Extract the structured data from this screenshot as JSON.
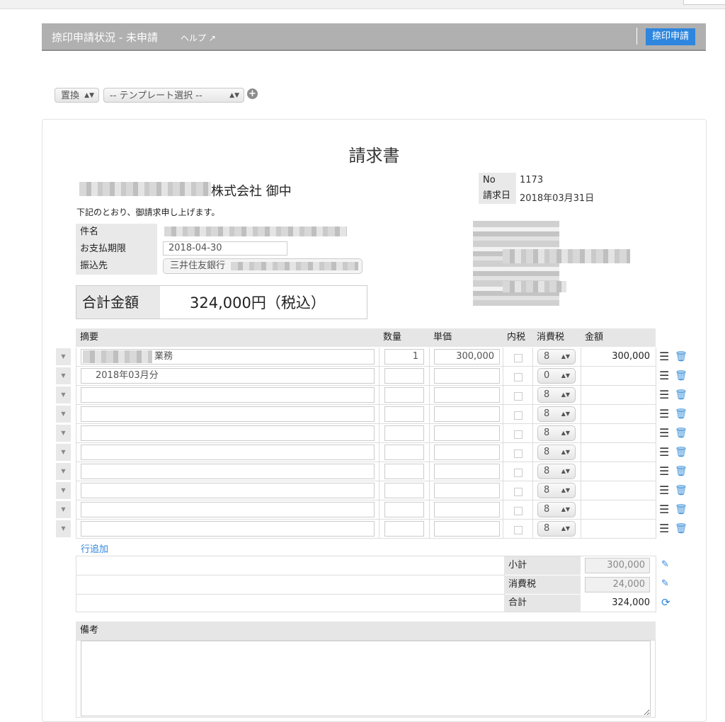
{
  "app": {
    "title": "捺印申請状況 - 未申請",
    "help_label": "ヘルプ",
    "help_icon": "↗",
    "apply_button": "捺印申請",
    "accent_color": "#2e86de"
  },
  "toolbar": {
    "replace_select": "置換",
    "template_select": "-- テンプレート選択 --",
    "add_icon": "+"
  },
  "invoice": {
    "title": "請求書",
    "recipient_suffix": "株式会社 御中",
    "intro": "下記のとおり、御請求申し上げます。",
    "no_label": "No",
    "no_value": "1173",
    "date_label": "請求日",
    "date_value": "2018年03月31日",
    "subject_label": "件名",
    "due_label": "お支払期限",
    "due_value": "2018-04-30",
    "bank_label": "振込先",
    "bank_value": "三井住友銀行",
    "total_label": "合計金額",
    "total_value": "324,000円（税込）"
  },
  "table": {
    "headers": {
      "description": "摘要",
      "quantity": "数量",
      "unit_price": "単価",
      "tax_included": "内税",
      "tax_rate": "消費税",
      "amount": "金額"
    },
    "rows": [
      {
        "description": "業務",
        "quantity": "1",
        "unit_price": "300,000",
        "tax": "8",
        "amount": "300,000"
      },
      {
        "description": "2018年03月分",
        "quantity": "",
        "unit_price": "",
        "tax": "0",
        "amount": ""
      },
      {
        "description": "",
        "quantity": "",
        "unit_price": "",
        "tax": "8",
        "amount": ""
      },
      {
        "description": "",
        "quantity": "",
        "unit_price": "",
        "tax": "8",
        "amount": ""
      },
      {
        "description": "",
        "quantity": "",
        "unit_price": "",
        "tax": "8",
        "amount": ""
      },
      {
        "description": "",
        "quantity": "",
        "unit_price": "",
        "tax": "8",
        "amount": ""
      },
      {
        "description": "",
        "quantity": "",
        "unit_price": "",
        "tax": "8",
        "amount": ""
      },
      {
        "description": "",
        "quantity": "",
        "unit_price": "",
        "tax": "8",
        "amount": ""
      },
      {
        "description": "",
        "quantity": "",
        "unit_price": "",
        "tax": "8",
        "amount": ""
      },
      {
        "description": "",
        "quantity": "",
        "unit_price": "",
        "tax": "8",
        "amount": ""
      }
    ],
    "add_row": "行追加"
  },
  "totals": {
    "subtotal_label": "小計",
    "subtotal_value": "300,000",
    "tax_label": "消費税",
    "tax_value": "24,000",
    "total_label": "合計",
    "total_value": "324,000"
  },
  "notes": {
    "label": "備考"
  },
  "icons": {
    "row_arrow": "▼",
    "select_arrows": "▲▼",
    "menu": "☰",
    "trash": "🗑",
    "pencil": "✎",
    "refresh": "⟳"
  }
}
